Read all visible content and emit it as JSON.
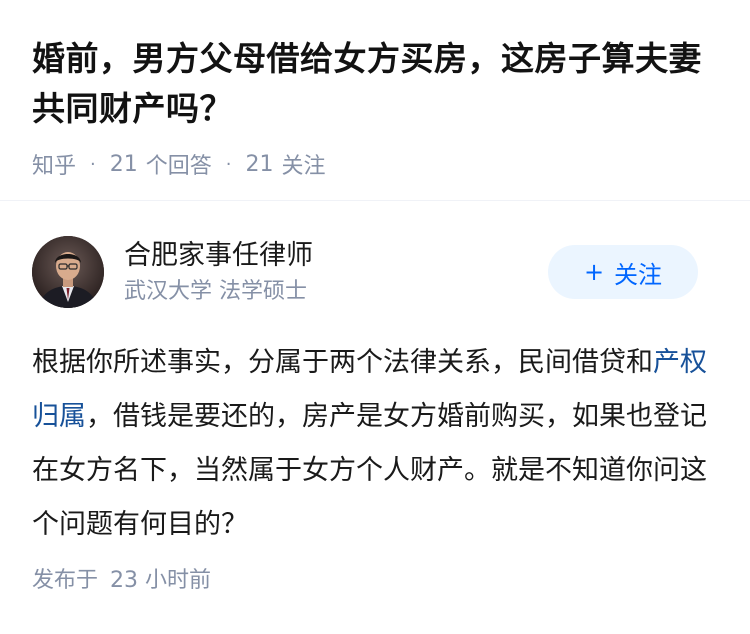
{
  "question": {
    "title": "婚前，男方父母借给女方买房，这房子算夫妻共同财产吗？",
    "source": "知乎",
    "answers_count": "21",
    "answers_label": "个回答",
    "followers_count": "21",
    "followers_label": "关注"
  },
  "author": {
    "name": "合肥家事任律师",
    "bio": "武汉大学 法学硕士",
    "follow_label": "关注",
    "follow_icon": "plus-icon"
  },
  "answer": {
    "text_before": "根据你所述事实，分属于两个法律关系，民间借贷和",
    "link_text": "产权归属",
    "text_after": "，借钱是要还的，房产是女方婚前购买，如果也登记在女方名下，当然属于女方个人财产。就是不知道你问这个问题有何目的？"
  },
  "footer": {
    "published_label": "发布于",
    "published_time": "23 小时前"
  },
  "colors": {
    "muted": "#8590a6",
    "link": "#175199",
    "accent": "#0066ff",
    "button_bg": "#ebf5ff"
  }
}
